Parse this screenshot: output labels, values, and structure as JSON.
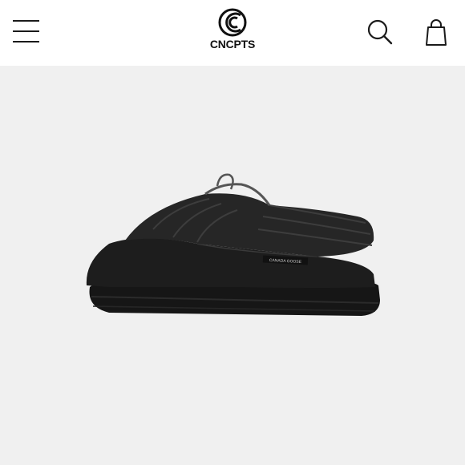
{
  "header": {
    "logo_text": "CNCPTS",
    "menu_icon": "hamburger-menu-icon",
    "search_icon": "search-icon",
    "bag_icon": "shopping-bag-icon"
  },
  "product": {
    "image": "product-photo",
    "subject": "black quilted slip-on mule with lug sole",
    "label_text": "CANADA GOOSE"
  },
  "colors": {
    "header_bg": "#ffffff",
    "hero_bg": "#f0f0f0",
    "icon": "#1a1a1a"
  }
}
